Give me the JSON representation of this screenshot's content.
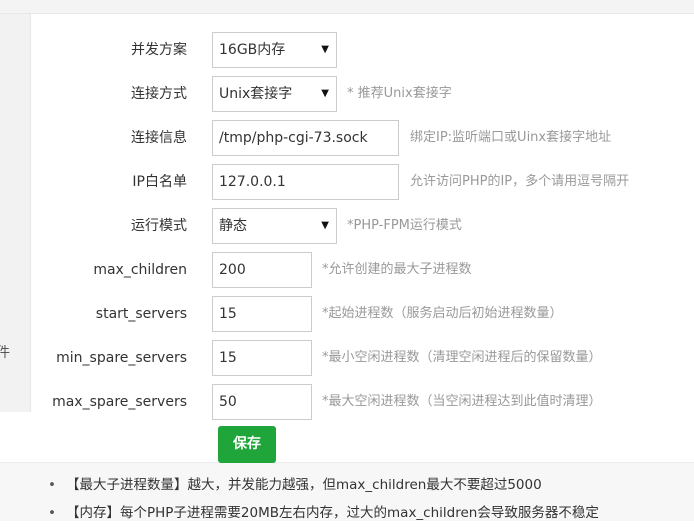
{
  "side_label": "件",
  "form": {
    "concurrency": {
      "label": "并发方案",
      "value": "16GB内存"
    },
    "connection_mode": {
      "label": "连接方式",
      "value": "Unix套接字",
      "hint": "* 推荐Unix套接字"
    },
    "connection_info": {
      "label": "连接信息",
      "value": "/tmp/php-cgi-73.sock",
      "hint": "绑定IP:监听端口或Uinx套接字地址"
    },
    "ip_whitelist": {
      "label": "IP白名单",
      "value": "127.0.0.1",
      "hint": "允许访问PHP的IP，多个请用逗号隔开"
    },
    "run_mode": {
      "label": "运行模式",
      "value": "静态",
      "hint": "*PHP-FPM运行模式"
    },
    "max_children": {
      "label": "max_children",
      "value": "200",
      "hint": "*允许创建的最大子进程数"
    },
    "start_servers": {
      "label": "start_servers",
      "value": "15",
      "hint": "*起始进程数（服务启动后初始进程数量）"
    },
    "min_spare_servers": {
      "label": "min_spare_servers",
      "value": "15",
      "hint": "*最小空闲进程数（清理空闲进程后的保留数量）"
    },
    "max_spare_servers": {
      "label": "max_spare_servers",
      "value": "50",
      "hint": "*最大空闲进程数（当空闲进程达到此值时清理）"
    }
  },
  "save_label": "保存",
  "notes": [
    "【最大子进程数量】越大，并发能力越强，但max_children最大不要超过5000",
    "【内存】每个PHP子进程需要20MB左右内存，过大的max_children会导致服务器不稳定"
  ]
}
